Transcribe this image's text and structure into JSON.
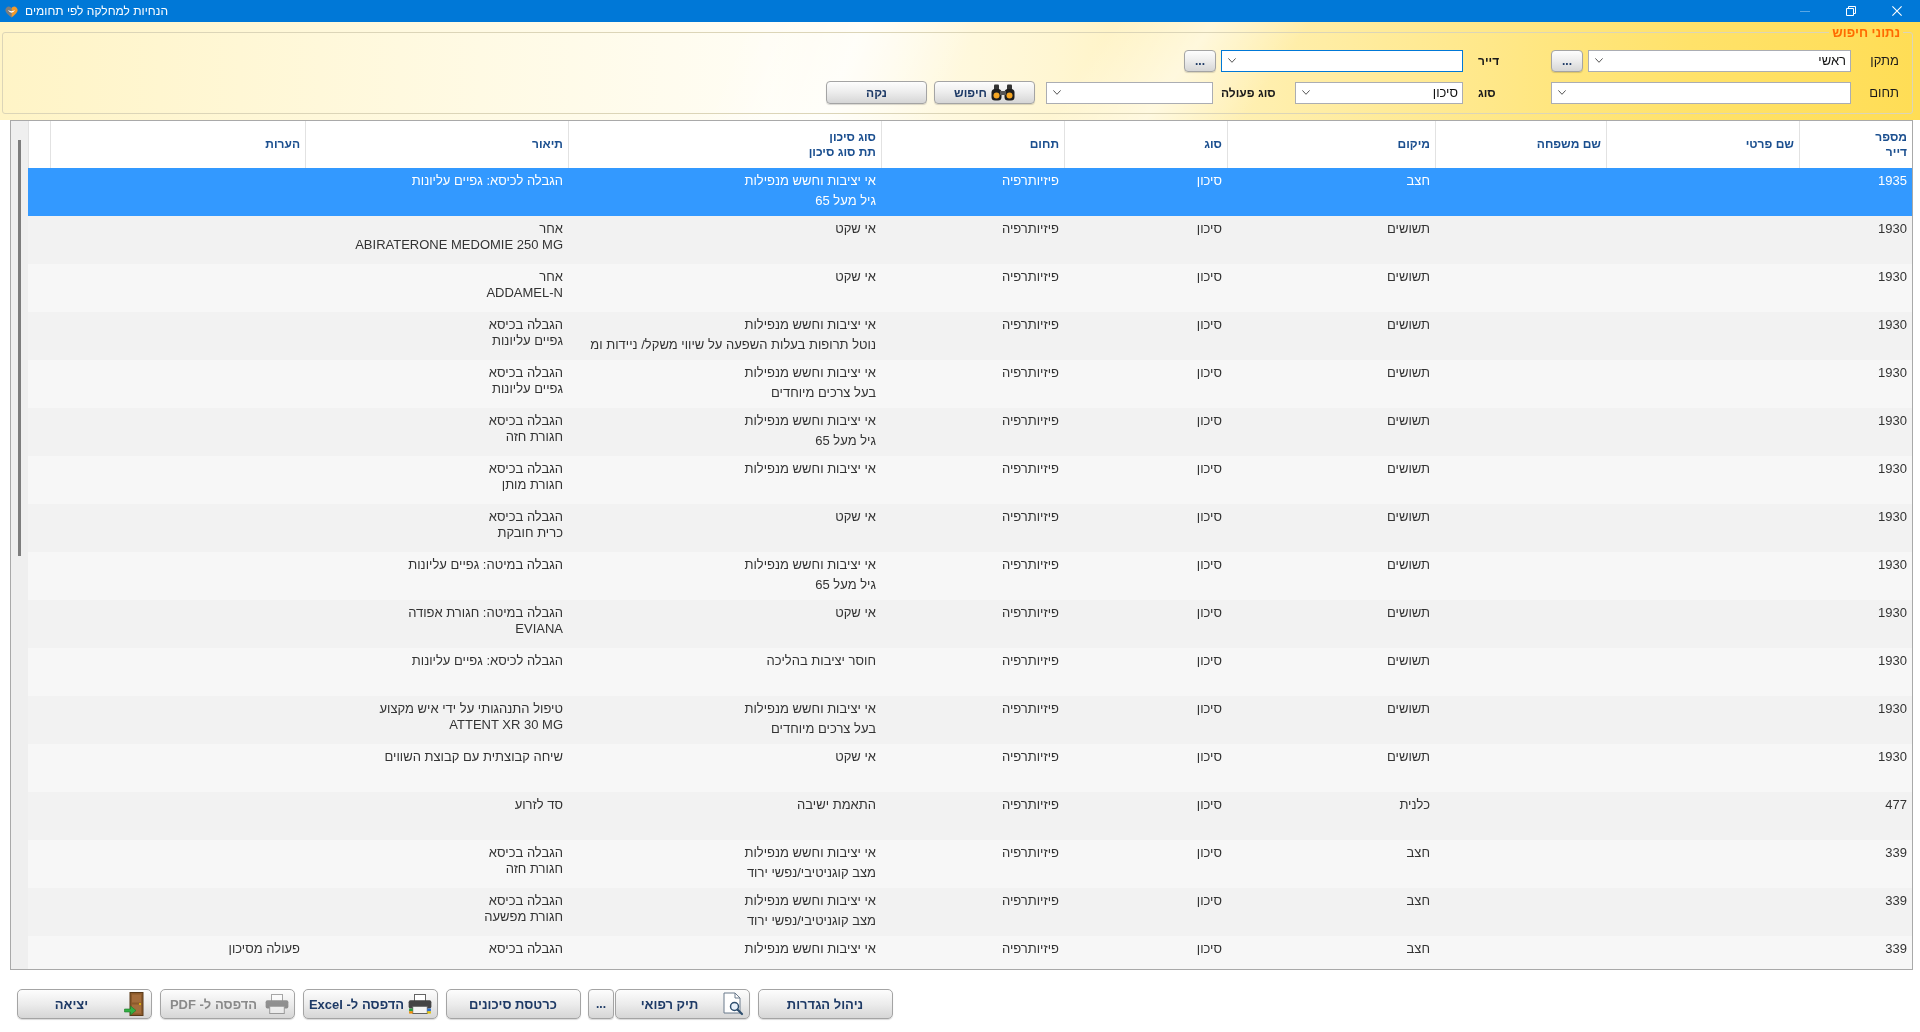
{
  "window": {
    "title": "הנחיות למחלקה לפי תחומים",
    "controls": [
      {
        "kind": "minimize",
        "disabled": true
      },
      {
        "kind": "restore",
        "disabled": false
      },
      {
        "kind": "close",
        "disabled": false
      }
    ]
  },
  "search": {
    "legend": "נתוני חיפוש",
    "rows": [
      [
        {
          "label": "מתקן",
          "value": "ראשי",
          "browse": "...",
          "focused": false
        },
        {
          "label": "דייר",
          "browse": "...",
          "focused": true
        }
      ],
      [
        {
          "label": "תחום",
          "focused": false
        },
        {
          "label": "סוג",
          "value": "סיכון",
          "focused": false
        },
        {
          "label": "סוג פעולה",
          "focused": false
        }
      ]
    ],
    "buttons": [
      {
        "label": "חיפוש",
        "kind": "search"
      },
      {
        "label": "נקה",
        "kind": "clear"
      }
    ]
  },
  "table": {
    "columns": [
      {
        "label": "מספר\nדייר"
      },
      {
        "label": "שם פרטי"
      },
      {
        "label": "שם משפחה"
      },
      {
        "label": "מיקום"
      },
      {
        "label": "סוג"
      },
      {
        "label": "תחום"
      },
      {
        "label": "סוג סיכון\nתת סוג סיכון"
      },
      {
        "label": "תיאור"
      },
      {
        "label": "הערות"
      }
    ],
    "rows": [
      {
        "resident_number": "1935",
        "location": "חצב",
        "type": "סיכון",
        "domain": "פיזיותרפיה",
        "risk_type": "אי יציבות וחשש מנפילות",
        "risk_subtype": "גיל מעל 65",
        "description": "הגבלה לכיסא: גפיים עליונות",
        "selected": true
      },
      {
        "resident_number": "1930",
        "location": "תשושים",
        "type": "סיכון",
        "domain": "פיזיותרפיה",
        "risk_type": "אי שקט",
        "description": "אחר\nABIRATERONE MEDOMIE 250 MG",
        "selected": false
      },
      {
        "resident_number": "1930",
        "location": "תשושים",
        "type": "סיכון",
        "domain": "פיזיותרפיה",
        "risk_type": "אי שקט",
        "description": "אחר\nADDAMEL-N",
        "selected": false
      },
      {
        "resident_number": "1930",
        "location": "תשושים",
        "type": "סיכון",
        "domain": "פיזיותרפיה",
        "risk_type": "אי יציבות וחשש מנפילות",
        "risk_subtype": "נוטל תרופות בעלות השפעה על שיווי משקל/ ניידות ומ",
        "description": "הגבלה בכיסא\nגפיים עליונות",
        "selected": false
      },
      {
        "resident_number": "1930",
        "location": "תשושים",
        "type": "סיכון",
        "domain": "פיזיותרפיה",
        "risk_type": "אי יציבות וחשש מנפילות",
        "risk_subtype": "בעל צרכים מיוחדים",
        "description": "הגבלה בכיסא\nגפיים עליונות",
        "selected": false
      },
      {
        "resident_number": "1930",
        "location": "תשושים",
        "type": "סיכון",
        "domain": "פיזיותרפיה",
        "risk_type": "אי יציבות וחשש מנפילות",
        "risk_subtype": "גיל מעל 65",
        "description": "הגבלה בכיסא\nחגורת חזה",
        "selected": false
      },
      {
        "resident_number": "1930",
        "location": "תשושים",
        "type": "סיכון",
        "domain": "פיזיותרפיה",
        "risk_type": "אי יציבות וחשש מנפילות",
        "description": "הגבלה בכיסא\nחגורת מותן",
        "selected": false
      },
      {
        "resident_number": "1930",
        "location": "תשושים",
        "type": "סיכון",
        "domain": "פיזיותרפיה",
        "risk_type": "אי שקט",
        "description": "הגבלה בכיסא\nכרית חובקת",
        "selected": false
      },
      {
        "resident_number": "1930",
        "location": "תשושים",
        "type": "סיכון",
        "domain": "פיזיותרפיה",
        "risk_type": "אי יציבות וחשש מנפילות",
        "risk_subtype": "גיל מעל 65",
        "description": "הגבלה במיטה: גפיים עליונות",
        "selected": false
      },
      {
        "resident_number": "1930",
        "location": "תשושים",
        "type": "סיכון",
        "domain": "פיזיותרפיה",
        "risk_type": "אי שקט",
        "description": "הגבלה במיטה: חגורת אפודה\nEVIANA",
        "selected": false
      },
      {
        "resident_number": "1930",
        "location": "תשושים",
        "type": "סיכון",
        "domain": "פיזיותרפיה",
        "risk_type": "חוסר יציבות בהליכה",
        "description": "הגבלה לכיסא: גפיים עליונות",
        "selected": false
      },
      {
        "resident_number": "1930",
        "location": "תשושים",
        "type": "סיכון",
        "domain": "פיזיותרפיה",
        "risk_type": "אי יציבות וחשש מנפילות",
        "risk_subtype": "בעל צרכים מיוחדים",
        "description": "טיפול התנהגותי על ידי איש מקצוע\nATTENT XR 30 MG",
        "selected": false
      },
      {
        "resident_number": "1930",
        "location": "תשושים",
        "type": "סיכון",
        "domain": "פיזיותרפיה",
        "risk_type": "אי שקט",
        "description": "שיחה קבוצתית עם קבוצת השווים",
        "selected": false
      },
      {
        "resident_number": "477",
        "location": "כלנית",
        "type": "סיכון",
        "domain": "פיזיותרפיה",
        "risk_type": "התאמת ישיבה",
        "description": "סד לזרוע",
        "selected": false
      },
      {
        "resident_number": "339",
        "location": "חצב",
        "type": "סיכון",
        "domain": "פיזיותרפיה",
        "risk_type": "אי יציבות וחשש מנפילות",
        "risk_subtype": "מצב קוגניטיבי/נפשי ירוד",
        "description": "הגבלה בכיסא\nחגורת חזה",
        "selected": false
      },
      {
        "resident_number": "339",
        "location": "חצב",
        "type": "סיכון",
        "domain": "פיזיותרפיה",
        "risk_type": "אי יציבות וחשש מנפילות",
        "risk_subtype": "מצב קוגניטיבי/נפשי ירוד",
        "description": "הגבלה בכיסא\nחגורת מפשעה",
        "selected": false
      },
      {
        "resident_number": "339",
        "location": "חצב",
        "type": "סיכון",
        "domain": "פיזיותרפיה",
        "risk_type": "אי יציבות וחשש מנפילות",
        "description": "הגבלה בכיסא",
        "notes": "פעולה מסיכון",
        "selected": false
      }
    ]
  },
  "footer": {
    "buttons": [
      {
        "label": "ניהול הגדרות",
        "kind": "plain",
        "disabled": false
      },
      {
        "label": "תיק רפואי",
        "kind": "file",
        "disabled": false
      },
      {
        "label": "...",
        "kind": "more",
        "disabled": false
      },
      {
        "label": "כרטסת סיכונים",
        "kind": "plain",
        "disabled": false
      },
      {
        "label": "הדפסה ל- Excel",
        "kind": "excel",
        "disabled": false
      },
      {
        "label": "הדפסה ל- PDF",
        "kind": "pdf",
        "disabled": true
      },
      {
        "label": "יציאה",
        "kind": "exit",
        "disabled": false
      }
    ]
  }
}
